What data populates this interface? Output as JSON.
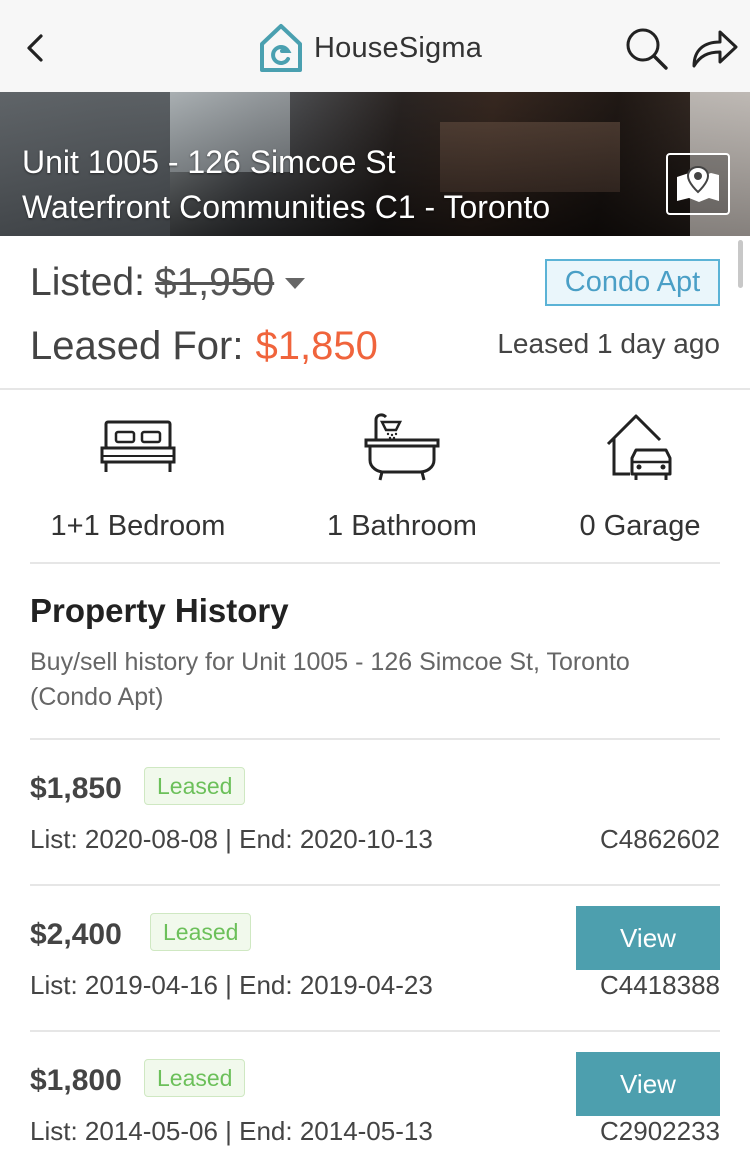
{
  "header": {
    "back_icon": "chevron-left-icon",
    "brand_icon": "housesigma-logo-icon",
    "brand_name": "HouseSigma",
    "brand_color": "#4aa0b0",
    "search_icon": "search-icon",
    "share_icon": "share-arrow-icon"
  },
  "hero": {
    "address_line1": "Unit 1005 - 126 Simcoe St",
    "address_line2": "Waterfront Communities C1 - Toronto",
    "map_icon": "map-pin-icon"
  },
  "listing": {
    "listed_label": "Listed:",
    "listed_price": "$1,950",
    "property_type": "Condo Apt",
    "leased_label": "Leased For:",
    "leased_price": "$1,850",
    "leased_price_color": "#f0643c",
    "leased_ago": "Leased 1 day ago"
  },
  "features": [
    {
      "icon": "bed-icon",
      "label": "1+1 Bedroom"
    },
    {
      "icon": "bathtub-icon",
      "label": "1 Bathroom"
    },
    {
      "icon": "garage-icon",
      "label": "0 Garage"
    }
  ],
  "history": {
    "title": "Property History",
    "subtitle": "Buy/sell history for Unit 1005 - 126 Simcoe St, Toronto (Condo Apt)",
    "rows": [
      {
        "price": "$1,850",
        "status": "Leased",
        "dates": "List: 2020-08-08 | End: 2020-10-13",
        "mls": "C4862602",
        "has_view": false,
        "view_label": ""
      },
      {
        "price": "$2,400",
        "status": "Leased",
        "dates": "List: 2019-04-16 | End: 2019-04-23",
        "mls": "C4418388",
        "has_view": true,
        "view_label": "View"
      },
      {
        "price": "$1,800",
        "status": "Leased",
        "dates": "List: 2014-05-06 | End: 2014-05-13",
        "mls": "C2902233",
        "has_view": true,
        "view_label": "View"
      }
    ]
  }
}
